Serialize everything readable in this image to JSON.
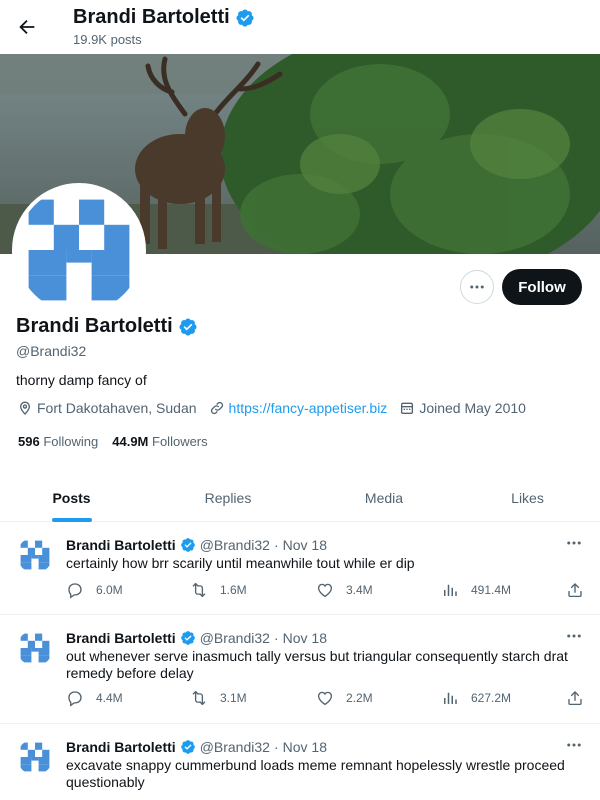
{
  "header": {
    "name": "Brandi Bartoletti",
    "posts_count": "19.9K posts"
  },
  "profile": {
    "name": "Brandi Bartoletti",
    "handle": "@Brandi32",
    "bio": "thorny damp fancy of",
    "location": "Fort Dakotahaven, Sudan",
    "website": "https://fancy-appetiser.biz",
    "joined": "Joined May 2010",
    "following_count": "596",
    "following_label": "Following",
    "followers_count": "44.9M",
    "followers_label": "Followers",
    "follow_label": "Follow"
  },
  "tabs": [
    {
      "label": "Posts",
      "active": true
    },
    {
      "label": "Replies",
      "active": false
    },
    {
      "label": "Media",
      "active": false
    },
    {
      "label": "Likes",
      "active": false
    }
  ],
  "tweets": [
    {
      "name": "Brandi Bartoletti",
      "handle": "@Brandi32",
      "sep": "·",
      "date": "Nov 18",
      "text": "certainly how brr scarily until meanwhile tout while er dip",
      "replies": "6.0M",
      "reposts": "1.6M",
      "likes": "3.4M",
      "views": "491.4M"
    },
    {
      "name": "Brandi Bartoletti",
      "handle": "@Brandi32",
      "sep": "·",
      "date": "Nov 18",
      "text": "out whenever serve inasmuch tally versus but triangular consequently starch drat remedy before delay",
      "replies": "4.4M",
      "reposts": "3.1M",
      "likes": "2.2M",
      "views": "627.2M"
    },
    {
      "name": "Brandi Bartoletti",
      "handle": "@Brandi32",
      "sep": "·",
      "date": "Nov 18",
      "text": "excavate snappy cummerbund loads meme remnant hopelessly wrestle proceed questionably"
    }
  ],
  "colors": {
    "accent": "#1d9bf0",
    "avatar_blue": "#4a90d9",
    "text_primary": "#0f1419",
    "text_secondary": "#536471"
  },
  "icons": {
    "back": "arrow-left-icon",
    "verified": "verified-badge-icon",
    "location": "location-pin-icon",
    "link": "link-icon",
    "calendar": "calendar-icon",
    "reply": "reply-icon",
    "repost": "repost-icon",
    "like": "heart-icon",
    "views": "views-icon",
    "share": "share-icon",
    "more": "more-icon"
  }
}
